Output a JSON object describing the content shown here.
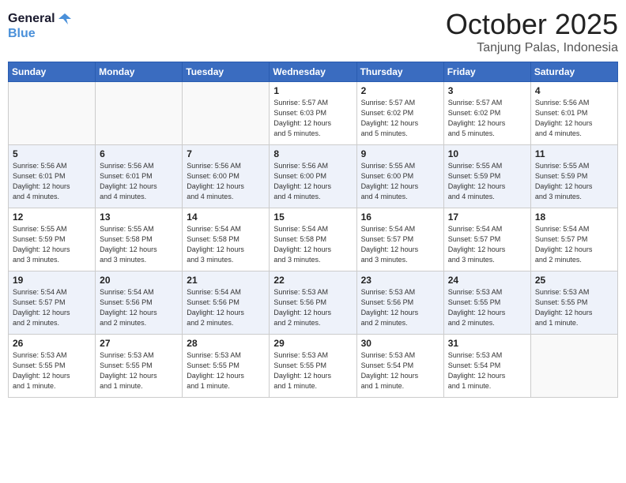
{
  "header": {
    "logo_line1": "General",
    "logo_line2": "Blue",
    "month": "October 2025",
    "location": "Tanjung Palas, Indonesia"
  },
  "weekdays": [
    "Sunday",
    "Monday",
    "Tuesday",
    "Wednesday",
    "Thursday",
    "Friday",
    "Saturday"
  ],
  "weeks": [
    [
      {
        "day": "",
        "info": ""
      },
      {
        "day": "",
        "info": ""
      },
      {
        "day": "",
        "info": ""
      },
      {
        "day": "1",
        "info": "Sunrise: 5:57 AM\nSunset: 6:03 PM\nDaylight: 12 hours\nand 5 minutes."
      },
      {
        "day": "2",
        "info": "Sunrise: 5:57 AM\nSunset: 6:02 PM\nDaylight: 12 hours\nand 5 minutes."
      },
      {
        "day": "3",
        "info": "Sunrise: 5:57 AM\nSunset: 6:02 PM\nDaylight: 12 hours\nand 5 minutes."
      },
      {
        "day": "4",
        "info": "Sunrise: 5:56 AM\nSunset: 6:01 PM\nDaylight: 12 hours\nand 4 minutes."
      }
    ],
    [
      {
        "day": "5",
        "info": "Sunrise: 5:56 AM\nSunset: 6:01 PM\nDaylight: 12 hours\nand 4 minutes."
      },
      {
        "day": "6",
        "info": "Sunrise: 5:56 AM\nSunset: 6:01 PM\nDaylight: 12 hours\nand 4 minutes."
      },
      {
        "day": "7",
        "info": "Sunrise: 5:56 AM\nSunset: 6:00 PM\nDaylight: 12 hours\nand 4 minutes."
      },
      {
        "day": "8",
        "info": "Sunrise: 5:56 AM\nSunset: 6:00 PM\nDaylight: 12 hours\nand 4 minutes."
      },
      {
        "day": "9",
        "info": "Sunrise: 5:55 AM\nSunset: 6:00 PM\nDaylight: 12 hours\nand 4 minutes."
      },
      {
        "day": "10",
        "info": "Sunrise: 5:55 AM\nSunset: 5:59 PM\nDaylight: 12 hours\nand 4 minutes."
      },
      {
        "day": "11",
        "info": "Sunrise: 5:55 AM\nSunset: 5:59 PM\nDaylight: 12 hours\nand 3 minutes."
      }
    ],
    [
      {
        "day": "12",
        "info": "Sunrise: 5:55 AM\nSunset: 5:59 PM\nDaylight: 12 hours\nand 3 minutes."
      },
      {
        "day": "13",
        "info": "Sunrise: 5:55 AM\nSunset: 5:58 PM\nDaylight: 12 hours\nand 3 minutes."
      },
      {
        "day": "14",
        "info": "Sunrise: 5:54 AM\nSunset: 5:58 PM\nDaylight: 12 hours\nand 3 minutes."
      },
      {
        "day": "15",
        "info": "Sunrise: 5:54 AM\nSunset: 5:58 PM\nDaylight: 12 hours\nand 3 minutes."
      },
      {
        "day": "16",
        "info": "Sunrise: 5:54 AM\nSunset: 5:57 PM\nDaylight: 12 hours\nand 3 minutes."
      },
      {
        "day": "17",
        "info": "Sunrise: 5:54 AM\nSunset: 5:57 PM\nDaylight: 12 hours\nand 3 minutes."
      },
      {
        "day": "18",
        "info": "Sunrise: 5:54 AM\nSunset: 5:57 PM\nDaylight: 12 hours\nand 2 minutes."
      }
    ],
    [
      {
        "day": "19",
        "info": "Sunrise: 5:54 AM\nSunset: 5:57 PM\nDaylight: 12 hours\nand 2 minutes."
      },
      {
        "day": "20",
        "info": "Sunrise: 5:54 AM\nSunset: 5:56 PM\nDaylight: 12 hours\nand 2 minutes."
      },
      {
        "day": "21",
        "info": "Sunrise: 5:54 AM\nSunset: 5:56 PM\nDaylight: 12 hours\nand 2 minutes."
      },
      {
        "day": "22",
        "info": "Sunrise: 5:53 AM\nSunset: 5:56 PM\nDaylight: 12 hours\nand 2 minutes."
      },
      {
        "day": "23",
        "info": "Sunrise: 5:53 AM\nSunset: 5:56 PM\nDaylight: 12 hours\nand 2 minutes."
      },
      {
        "day": "24",
        "info": "Sunrise: 5:53 AM\nSunset: 5:55 PM\nDaylight: 12 hours\nand 2 minutes."
      },
      {
        "day": "25",
        "info": "Sunrise: 5:53 AM\nSunset: 5:55 PM\nDaylight: 12 hours\nand 1 minute."
      }
    ],
    [
      {
        "day": "26",
        "info": "Sunrise: 5:53 AM\nSunset: 5:55 PM\nDaylight: 12 hours\nand 1 minute."
      },
      {
        "day": "27",
        "info": "Sunrise: 5:53 AM\nSunset: 5:55 PM\nDaylight: 12 hours\nand 1 minute."
      },
      {
        "day": "28",
        "info": "Sunrise: 5:53 AM\nSunset: 5:55 PM\nDaylight: 12 hours\nand 1 minute."
      },
      {
        "day": "29",
        "info": "Sunrise: 5:53 AM\nSunset: 5:55 PM\nDaylight: 12 hours\nand 1 minute."
      },
      {
        "day": "30",
        "info": "Sunrise: 5:53 AM\nSunset: 5:54 PM\nDaylight: 12 hours\nand 1 minute."
      },
      {
        "day": "31",
        "info": "Sunrise: 5:53 AM\nSunset: 5:54 PM\nDaylight: 12 hours\nand 1 minute."
      },
      {
        "day": "",
        "info": ""
      }
    ]
  ]
}
